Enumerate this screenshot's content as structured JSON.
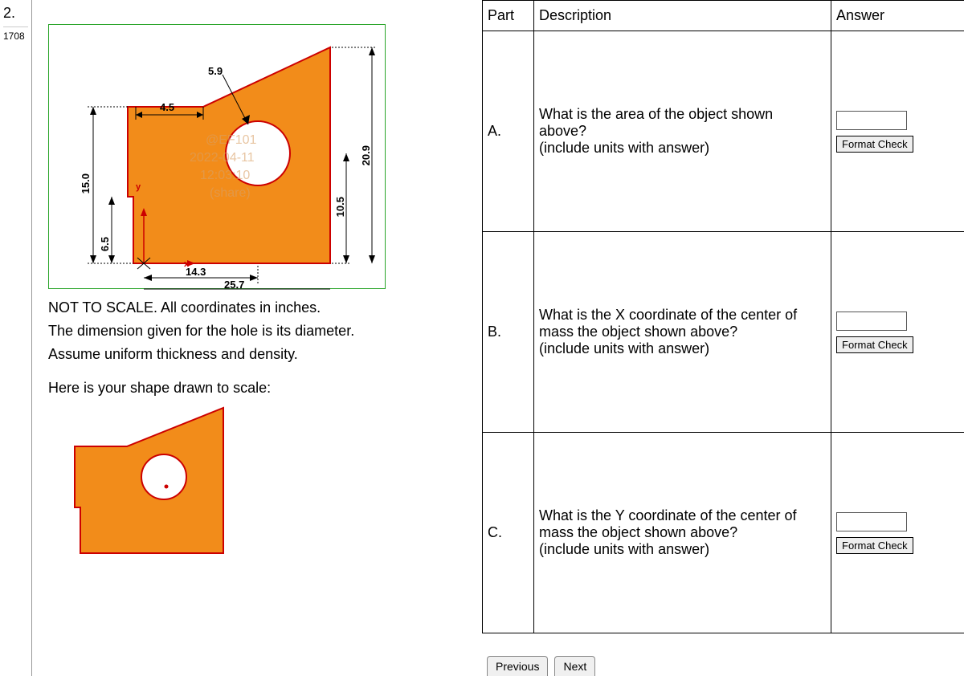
{
  "question": {
    "number": "2.",
    "points": "1708"
  },
  "figure": {
    "dims": {
      "d59": "5.9",
      "d45": "4.5",
      "d150": "15.0",
      "d65": "6.5",
      "d143": "14.3",
      "d257": "25.7",
      "d105": "10.5",
      "d209": "20.9"
    },
    "watermark": {
      "l1": "@EF101",
      "l2": "2022-04-11",
      "l3": "12:03:10",
      "l4": "(share)"
    },
    "axis_y": "y",
    "axis_x": "x"
  },
  "notes": {
    "l1": "NOT TO SCALE. All coordinates in inches.",
    "l2": "The dimension given for the hole is its diameter.",
    "l3": "Assume uniform thickness and density."
  },
  "lead": "Here is your shape drawn to scale:",
  "table": {
    "headers": {
      "part": "Part",
      "desc": "Description",
      "ans": "Answer"
    },
    "rows": [
      {
        "part": "A.",
        "desc_l1": "What is the area of the object shown",
        "desc_l2": "above?",
        "desc_l3": "(include units with answer)"
      },
      {
        "part": "B.",
        "desc_l1": "What is the X coordinate of the center of",
        "desc_l2": "mass the object shown above?",
        "desc_l3": "(include units with answer)"
      },
      {
        "part": "C.",
        "desc_l1": "What is the Y coordinate of the center of",
        "desc_l2": "mass the object shown above?",
        "desc_l3": "(include units with answer)"
      }
    ],
    "format_check_label": "Format Check",
    "prev_label": "Previous",
    "next_label": "Next"
  },
  "colors": {
    "shape_fill": "#f28c1a",
    "shape_stroke": "#c00",
    "accent": "#2aa52a"
  }
}
